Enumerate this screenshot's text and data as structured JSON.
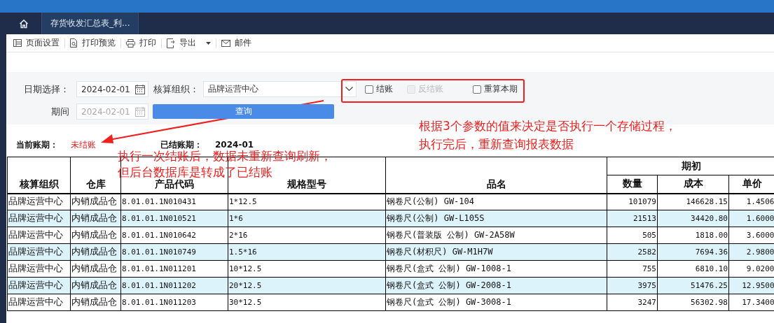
{
  "tabs": [
    {
      "kind": "home",
      "selected": false
    },
    {
      "kind": "page",
      "label": "存货收发汇总表_利...",
      "selected": true
    }
  ],
  "toolbar": [
    {
      "kind": "page-setup",
      "label": "页面设置",
      "dropdown": false
    },
    {
      "kind": "preview",
      "label": "打印预览",
      "dropdown": false
    },
    {
      "kind": "print",
      "label": "打印",
      "dropdown": false
    },
    {
      "kind": "export",
      "label": "导出",
      "dropdown": true
    },
    {
      "kind": "mail",
      "label": "邮件",
      "dropdown": false
    }
  ],
  "filters": {
    "date_label": "日期选择：",
    "date_value": "2024-02-01",
    "org_label": "核算组织：",
    "org_value": "品牌运营中心",
    "period_label": "期间",
    "period_value": "2024-02-01",
    "query_button": "查询"
  },
  "options": [
    {
      "label": "结账",
      "checked": false,
      "disabled": false
    },
    {
      "label": "反结账",
      "checked": false,
      "disabled": true
    },
    {
      "label": "重算本期",
      "checked": false,
      "disabled": false
    }
  ],
  "period": {
    "current_label": "当前账期：",
    "current_value": "未结账",
    "closed_label": "已结账期：",
    "closed_value": "2024-01"
  },
  "annotations": {
    "right": [
      "根据3个参数的值来决定是否执行一个存储过程，",
      "执行完后，重新查询报表数据"
    ],
    "left": [
      "执行一次结账后，数据未重新查询刷新，",
      "但后台数据库是转成了已结账"
    ]
  },
  "table": {
    "columns": [
      "核算组织",
      "仓库",
      "产品代码",
      "规格型号",
      "品名"
    ],
    "group": "期初",
    "group_columns": [
      "数量",
      "成本",
      "单价"
    ],
    "rows": [
      [
        "品牌运营中心",
        "内销成品仓",
        "8.01.01.1N010431",
        "1*12.5",
        "钢卷尺(公制) GW-104",
        "101079",
        "146628.15",
        "1.4506"
      ],
      [
        "品牌运营中心",
        "内销成品仓",
        "8.01.01.1N010521",
        "1*6",
        "钢卷尺(公制) GW-L105S",
        "21513",
        "34420.80",
        "1.6000"
      ],
      [
        "品牌运营中心",
        "内销成品仓",
        "8.01.01.1N010642",
        "2*16",
        "钢卷尺(普装版 公制) GW-2A58W",
        "505",
        "1818.00",
        "3.6000"
      ],
      [
        "品牌运营中心",
        "内销成品仓",
        "8.01.01.1N010749",
        "1.5*16",
        "钢卷尺(材积尺) GW-M1H7W",
        "2582",
        "7694.36",
        "2.9800"
      ],
      [
        "品牌运营中心",
        "内销成品仓",
        "8.01.01.1N011201",
        "10*12.5",
        "钢卷尺(盒式 公制) GW-1008-1",
        "755",
        "6810.10",
        "9.0200"
      ],
      [
        "品牌运营中心",
        "内销成品仓",
        "8.01.01.1N011202",
        "20*12.5",
        "钢卷尺(盒式 公制) GW-2008-1",
        "3975",
        "51476.25",
        "12.9500"
      ],
      [
        "品牌运营中心",
        "内销成品仓",
        "8.01.01.1N011203",
        "30*12.5",
        "钢卷尺(盒式 公制) GW-3008-1",
        "3247",
        "56302.98",
        "17.3400"
      ]
    ]
  }
}
